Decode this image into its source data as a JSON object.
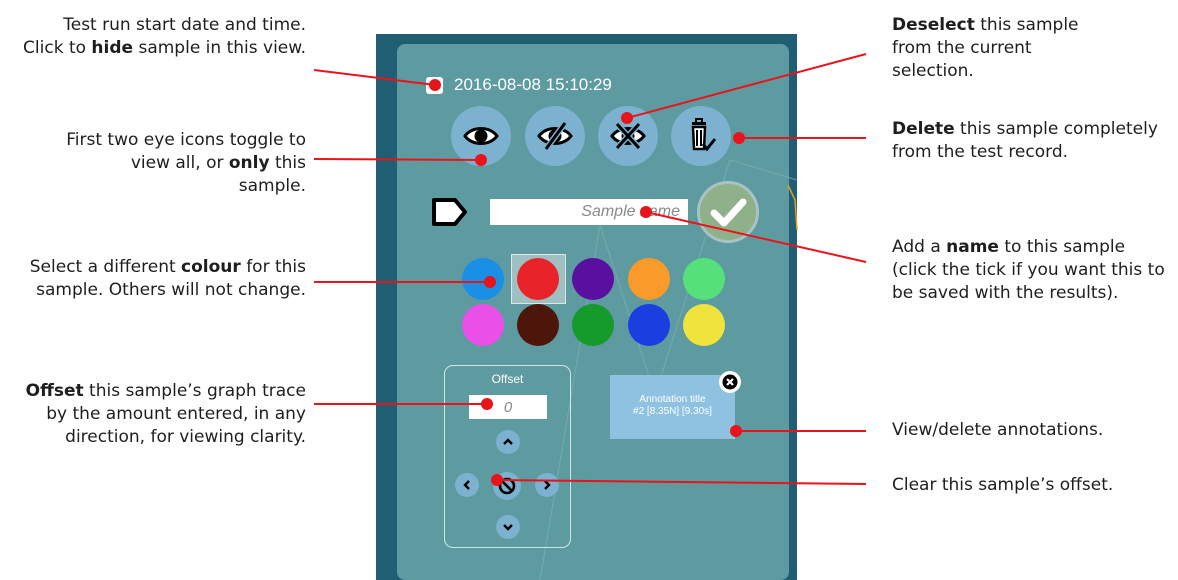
{
  "callouts": {
    "start_date": {
      "pre": "Test run start date and time. Click to ",
      "bold": "hide",
      "post": " sample in this view."
    },
    "eye_icons": {
      "pre": "First two eye icons toggle to view all, or ",
      "bold": "only",
      "post": " this sample."
    },
    "colour": {
      "pre": "Select a different ",
      "bold": "colour",
      "post": " for this sample. Others will not change."
    },
    "offset": {
      "pre": "",
      "bold": "Offset",
      "post": " this sample’s graph trace by the amount entered, in any direction, for viewing clarity."
    },
    "deselect": {
      "pre": "",
      "bold": "Deselect",
      "post": " this sample from the current selection."
    },
    "delete": {
      "pre": "",
      "bold": "Delete",
      "post": " this sample completely from the test record."
    },
    "name": {
      "pre": "Add a ",
      "bold": "name",
      "post": " to this sample (click the tick if you want this to be saved with the results)."
    },
    "annotations": {
      "pre": "View/delete annotations.",
      "bold": "",
      "post": ""
    },
    "clear_offset": {
      "pre": "Clear this sample’s offset.",
      "bold": "",
      "post": ""
    }
  },
  "panel": {
    "datetime": "2016-08-08 15:10:29",
    "visible_checked": false,
    "sample_name_placeholder": "Sample name",
    "offset_title": "Offset",
    "offset_placeholder": "0",
    "annotation_title": "Annotation title",
    "annotation_detail": "#2 [8.35N] [9.30s]",
    "selected_colour_index": 1,
    "colours": [
      "#1a8fe6",
      "#e8242a",
      "#5a0fa0",
      "#fa9a2a",
      "#55e07a",
      "#ea4fe8",
      "#4d160b",
      "#159a2c",
      "#1a3ee0",
      "#f0e43c"
    ]
  },
  "icons": {
    "view_all": "eye-icon",
    "view_only": "eye-slash-icon",
    "deselect": "eye-cross-icon",
    "delete": "trash-check-icon",
    "tag": "tag-icon",
    "save": "check-icon",
    "up": "chevron-up-icon",
    "down": "chevron-down-icon",
    "left": "chevron-left-icon",
    "right": "chevron-right-icon",
    "clear": "ban-icon",
    "close": "close-icon"
  },
  "colors": {
    "panel_bg": "#5d9ba1",
    "panel_dark": "#1f5e73",
    "button": "#7cb2cf",
    "callout_line": "#e8141b"
  }
}
